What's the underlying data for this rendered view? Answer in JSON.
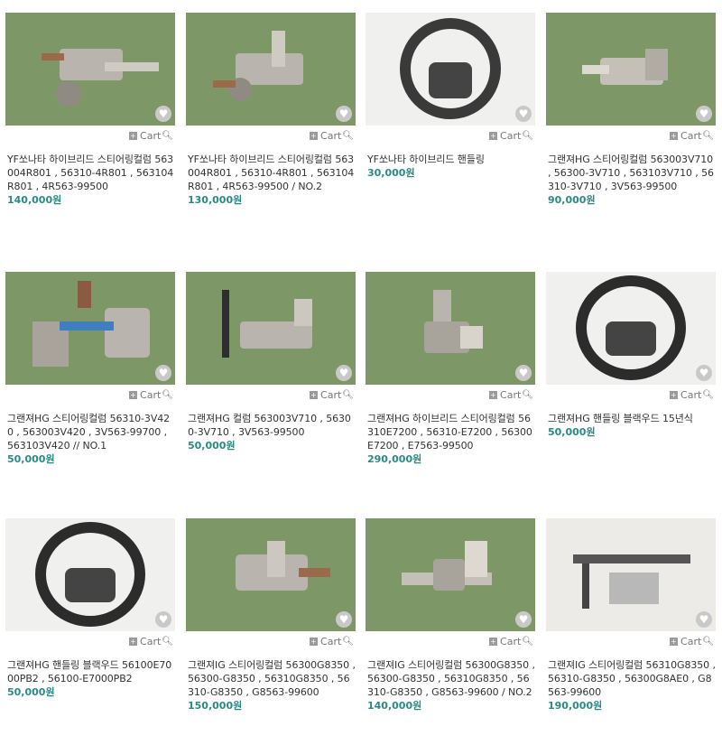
{
  "cart_label": "Cart",
  "products": [
    {
      "title": "YF쏘나타 하이브리드 스티어링컬럼 563004R801 , 56310-4R801 , 563104R801 , 4R563-99500",
      "price": "140,000원",
      "image": "steering-column"
    },
    {
      "title": "YF쏘나타 하이브리드 스티어링컬럼 563004R801 , 56310-4R801 , 563104R801 , 4R563-99500 / NO.2",
      "price": "130,000원",
      "image": "steering-column"
    },
    {
      "title": "YF쏘나타 하이브리드 핸들링",
      "price": "30,000원",
      "image": "steering-wheel"
    },
    {
      "title": "그랜져HG 스티어링컬럼 563003V710 , 56300-3V710 , 563103V710 , 56310-3V710 , 3V563-99500",
      "price": "90,000원",
      "image": "steering-column"
    },
    {
      "title": "그랜져HG 스티어링컬럼 56310-3V420 , 563003V420 , 3V563-99700 , 563103V420 // NO.1",
      "price": "50,000원",
      "image": "steering-column"
    },
    {
      "title": "그랜져HG 컬럼 563003V710 , 56300-3V710 , 3V563-99500",
      "price": "50,000원",
      "image": "steering-column"
    },
    {
      "title": "그랜져HG 하이브리드 스티어링컬럼 56310E7200 , 56310-E7200 , 56300E7200 , E7563-99500",
      "price": "290,000원",
      "image": "steering-column"
    },
    {
      "title": "그랜져HG 핸들링 블랙우드 15년식",
      "price": "50,000원",
      "image": "steering-wheel"
    },
    {
      "title": "그랜져HG 핸들링 블랙우드 56100E7000PB2 , 56100-E7000PB2",
      "price": "50,000원",
      "image": "steering-wheel"
    },
    {
      "title": "그랜져IG 스티어링컬럼 56300G8350 , 56300-G8350 , 56310G8350 , 56310-G8350 , G8563-99600",
      "price": "150,000원",
      "image": "steering-column"
    },
    {
      "title": "그랜져IG 스티어링컬럼 56300G8350 , 56300-G8350 , 56310G8350 , 56310-G8350 , G8563-99600 / NO.2",
      "price": "140,000원",
      "image": "steering-column"
    },
    {
      "title": "그랜져IG 스티어링컬럼 56310G8350 , 56310-G8350 , 56300G8AE0 , G8563-99600",
      "price": "190,000원",
      "image": "steering-column"
    }
  ]
}
